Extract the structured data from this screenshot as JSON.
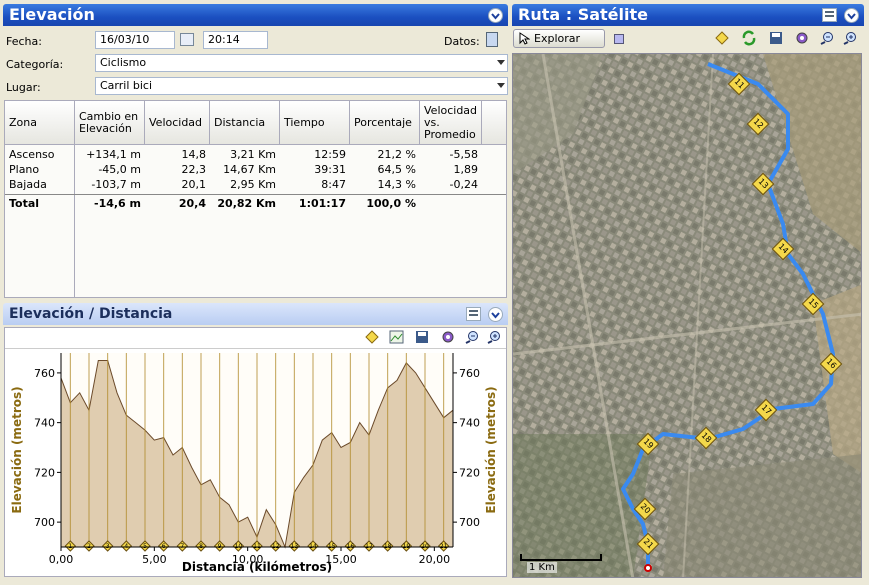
{
  "elevacion_panel": {
    "title": "Elevación",
    "fecha_label": "Fecha:",
    "fecha_value": "16/03/10",
    "hora_value": "20:14",
    "datos_label": "Datos:",
    "categoria_label": "Categoría:",
    "categoria_value": "Ciclismo",
    "lugar_label": "Lugar:",
    "lugar_value": "Carril bici"
  },
  "table": {
    "columns": [
      "Zona",
      "Cambio en Elevación",
      "Velocidad",
      "Distancia",
      "Tiempo",
      "Porcentaje",
      "Velocidad vs. Promedio"
    ],
    "rows": [
      [
        "Ascenso",
        "+134,1 m",
        "14,8",
        "3,21 Km",
        "12:59",
        "21,2 %",
        "-5,58"
      ],
      [
        "Plano",
        "-45,0 m",
        "22,3",
        "14,67 Km",
        "39:31",
        "64,5 %",
        "1,89"
      ],
      [
        "Bajada",
        "-103,7 m",
        "20,1",
        "2,95 Km",
        "8:47",
        "14,3 %",
        "-0,24"
      ],
      [
        "Total",
        "-14,6 m",
        "20,4",
        "20,82 Km",
        "1:01:17",
        "100,0 %",
        ""
      ]
    ]
  },
  "chart_panel": {
    "title": "Elevación / Distancia"
  },
  "chart_data": {
    "type": "area",
    "xlabel": "Distancia (kilómetros)",
    "ylabel": "Elevación (metros)",
    "xlim": [
      0,
      21
    ],
    "ylim": [
      690,
      768
    ],
    "x_ticks": [
      "0,00",
      "5,00",
      "10,00",
      "15,00",
      "20,00"
    ],
    "y_ticks": [
      "760",
      "740",
      "720",
      "700"
    ],
    "markers": [
      "1",
      "2",
      "3",
      "4",
      "5",
      "6",
      "7",
      "8",
      "9",
      "10",
      "11",
      "12",
      "13",
      "14",
      "15",
      "16",
      "17",
      "18",
      "19",
      "20",
      "21"
    ],
    "series": [
      {
        "x": [
          0,
          0.5,
          1,
          1.5,
          2,
          2.5,
          3,
          3.5,
          4,
          4.5,
          5,
          5.5,
          6,
          6.5,
          7,
          7.5,
          8,
          8.5,
          9,
          9.5,
          10,
          10.5,
          11,
          11.5,
          12,
          12.5,
          13,
          13.5,
          14,
          14.5,
          15,
          15.5,
          16,
          16.5,
          17,
          17.5,
          18,
          18.5,
          19,
          19.5,
          20,
          20.5,
          21
        ],
        "y": [
          758,
          748,
          752,
          745,
          765,
          765,
          752,
          743,
          740,
          737,
          733,
          734,
          727,
          730,
          722,
          715,
          717,
          710,
          707,
          700,
          702,
          694,
          705,
          699,
          690,
          712,
          718,
          723,
          733,
          736,
          730,
          732,
          740,
          735,
          745,
          754,
          757,
          764,
          760,
          754,
          748,
          742,
          745
        ]
      }
    ],
    "colors": {
      "fill": "#e0cdb0",
      "line": "#6b4a2a",
      "grid": "#b08a2a"
    }
  },
  "ruta_panel": {
    "title": "Ruta : Satélite",
    "explorar_label": "Explorar",
    "scale_label": "1 Km",
    "route_markers": [
      "11",
      "12",
      "13",
      "14",
      "15",
      "16",
      "17",
      "18",
      "19",
      "20",
      "21"
    ]
  }
}
